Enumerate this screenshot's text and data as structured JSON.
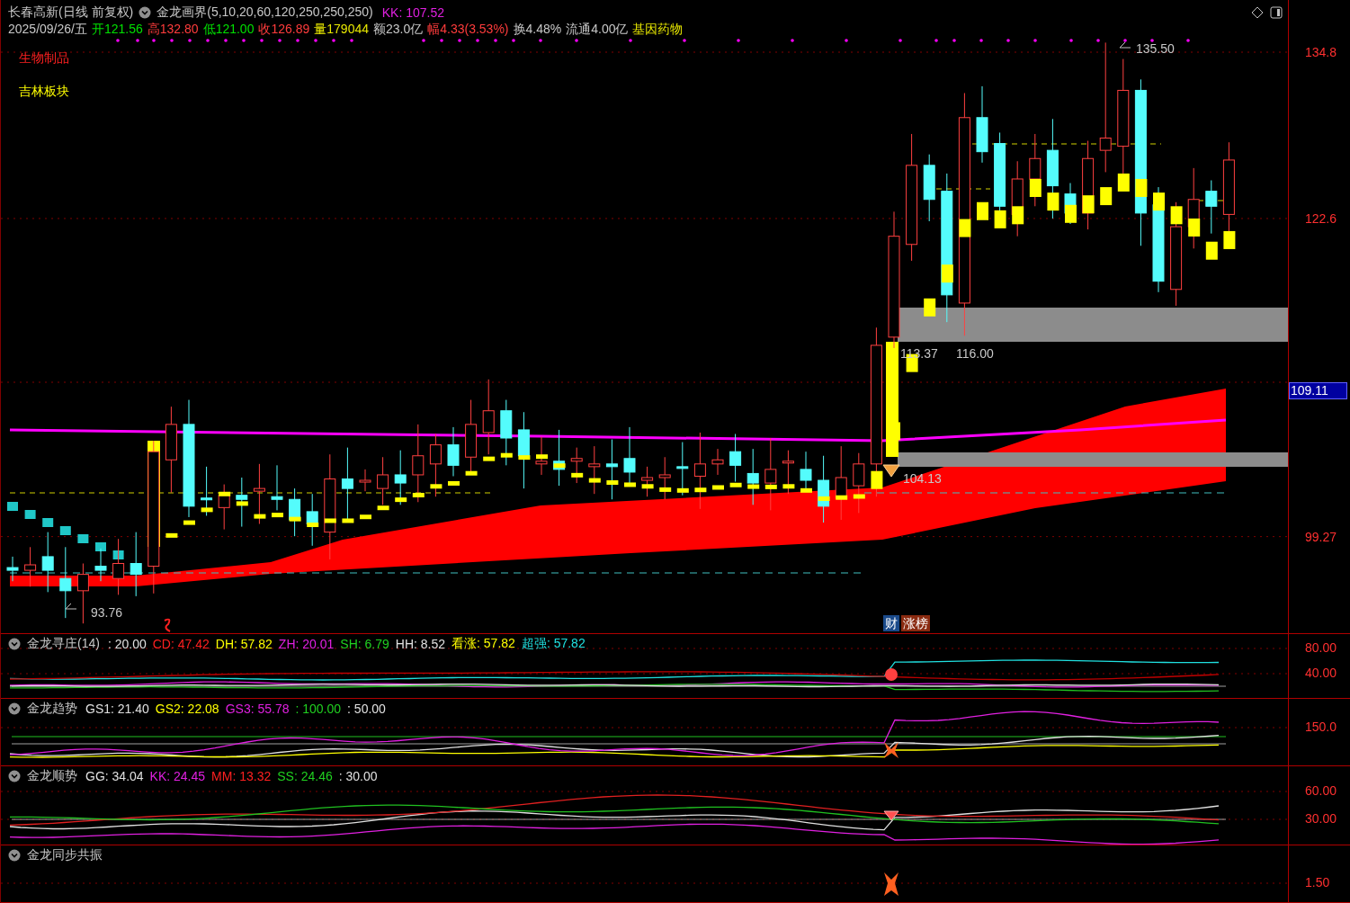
{
  "header": {
    "stock": "长春高新(日线 前复权)",
    "indicator": "金龙画界(5,10,20,60,120,250,250,250)",
    "kk": "KK: 107.52"
  },
  "quote": [
    {
      "text": "2025/09/26/五",
      "color": "#c8c8c8"
    },
    {
      "text": "开121.56",
      "color": "#00e000"
    },
    {
      "text": "高132.80",
      "color": "#ff3c3c"
    },
    {
      "text": "低121.00",
      "color": "#00e000"
    },
    {
      "text": "收126.89",
      "color": "#ff3c3c"
    },
    {
      "text": "量179044",
      "color": "#e8e800"
    },
    {
      "text": "额23.0亿",
      "color": "#c8c8c8"
    },
    {
      "text": "幅4.33(3.53%)",
      "color": "#ff3c3c"
    },
    {
      "text": "换4.48%",
      "color": "#c8c8c8"
    },
    {
      "text": "流通4.00亿",
      "color": "#c8c8c8"
    },
    {
      "text": "基因药物",
      "color": "#e8e800"
    }
  ],
  "tags": [
    {
      "text": "生物制品",
      "color": "#ff2020"
    },
    {
      "text": "吉林板块",
      "color": "#ffff00"
    }
  ],
  "price_labels": [
    "135.50",
    "93.76",
    "113.37",
    "116.00",
    "104.13"
  ],
  "markers": [
    "财",
    "涨榜"
  ],
  "axis": {
    "ticks": [
      "134.8",
      "122.6",
      "99.27"
    ],
    "current": "109.11"
  },
  "panels": [
    {
      "title": "金龙寻庄(14)",
      "values": [
        {
          "text": ": 20.00",
          "color": "#e0e0e0"
        },
        {
          "text": "CD: 47.42",
          "color": "#ff2020"
        },
        {
          "text": "DH: 57.82",
          "color": "#ffff00"
        },
        {
          "text": "ZH: 20.01",
          "color": "#e020e0"
        },
        {
          "text": "SH: 6.79",
          "color": "#20d020"
        },
        {
          "text": "HH: 8.52",
          "color": "#e0e0e0"
        },
        {
          "text": "看涨: 57.82",
          "color": "#ffff00"
        },
        {
          "text": "超强: 57.82",
          "color": "#20e0e0"
        }
      ],
      "ticks": [
        "80.00",
        "40.00"
      ]
    },
    {
      "title": "金龙趋势",
      "values": [
        {
          "text": "GS1: 21.40",
          "color": "#e0e0e0"
        },
        {
          "text": "GS2: 22.08",
          "color": "#ffff00"
        },
        {
          "text": "GS3: 55.78",
          "color": "#e020e0"
        },
        {
          "text": ": 100.00",
          "color": "#20d020"
        },
        {
          "text": ": 50.00",
          "color": "#e0e0e0"
        }
      ],
      "ticks": [
        "150.0"
      ]
    },
    {
      "title": "金龙顺势",
      "values": [
        {
          "text": "GG: 34.04",
          "color": "#e0e0e0"
        },
        {
          "text": "KK: 24.45",
          "color": "#e020e0"
        },
        {
          "text": "MM: 13.32",
          "color": "#ff2020"
        },
        {
          "text": "SS: 24.46",
          "color": "#20d020"
        },
        {
          "text": ": 30.00",
          "color": "#e0e0e0"
        }
      ],
      "ticks": [
        "60.00",
        "30.00"
      ]
    },
    {
      "title": "金龙同步共振",
      "ticks": [
        "1.50"
      ]
    }
  ]
}
